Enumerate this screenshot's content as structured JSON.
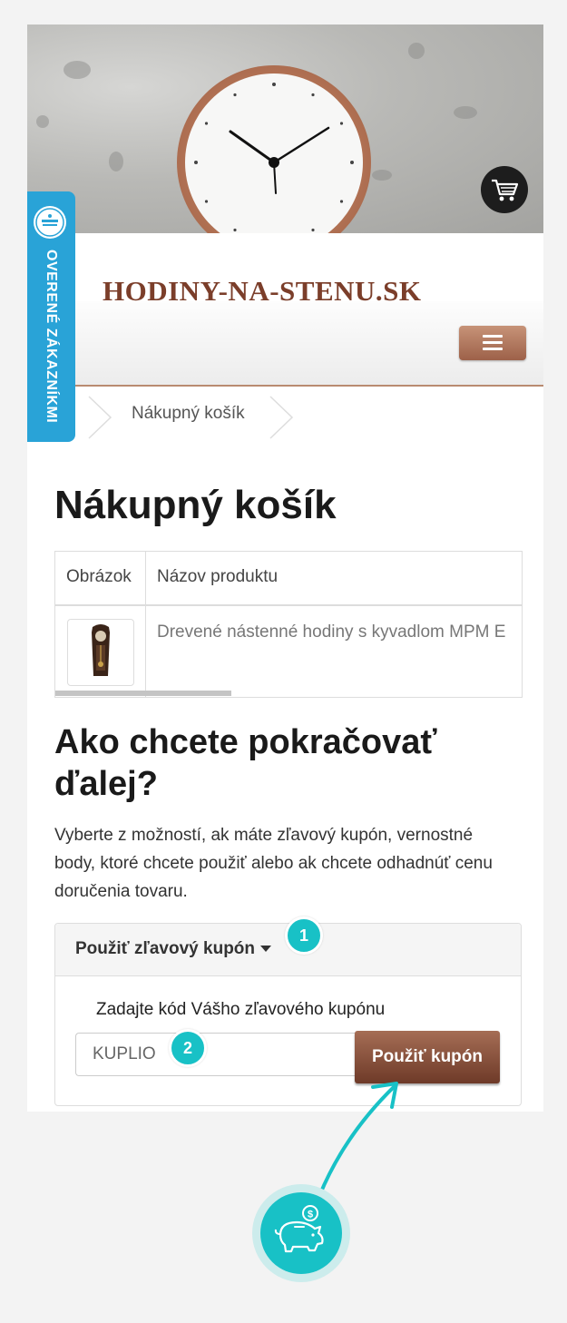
{
  "site": {
    "logo_text": "HODINY-NA-STENU.SK",
    "verified_badge_label": "OVERENÉ ZÁKAZNÍKMI"
  },
  "breadcrumb": {
    "current": "Nákupný košík"
  },
  "page_title": "Nákupný košík",
  "cart_table": {
    "headers": [
      "Obrázok",
      "Názov produktu"
    ],
    "rows": [
      {
        "product_name": "Drevené nástenné hodiny s kyvadlom MPM E"
      }
    ]
  },
  "next_steps": {
    "heading": "Ako chcete pokračovať ďalej?",
    "description": "Vyberte z možností, ak máte zľavový kupón, vernostné body, ktoré chcete použiť alebo ak chcete odhadnúť cenu doručenia tovaru."
  },
  "coupon_panel": {
    "title": "Použiť zľavový kupón",
    "field_label": "Zadajte kód Vášho zľavového kupónu",
    "input_value": "KUPLIO",
    "apply_button": "Použiť kupón"
  },
  "annotations": {
    "step_1": "1",
    "step_2": "2",
    "color": "#18c1c6"
  },
  "colors": {
    "brand_brown": "#7b3e2a",
    "button_brown": "#6e3a28",
    "badge_blue": "#29a3d7"
  }
}
